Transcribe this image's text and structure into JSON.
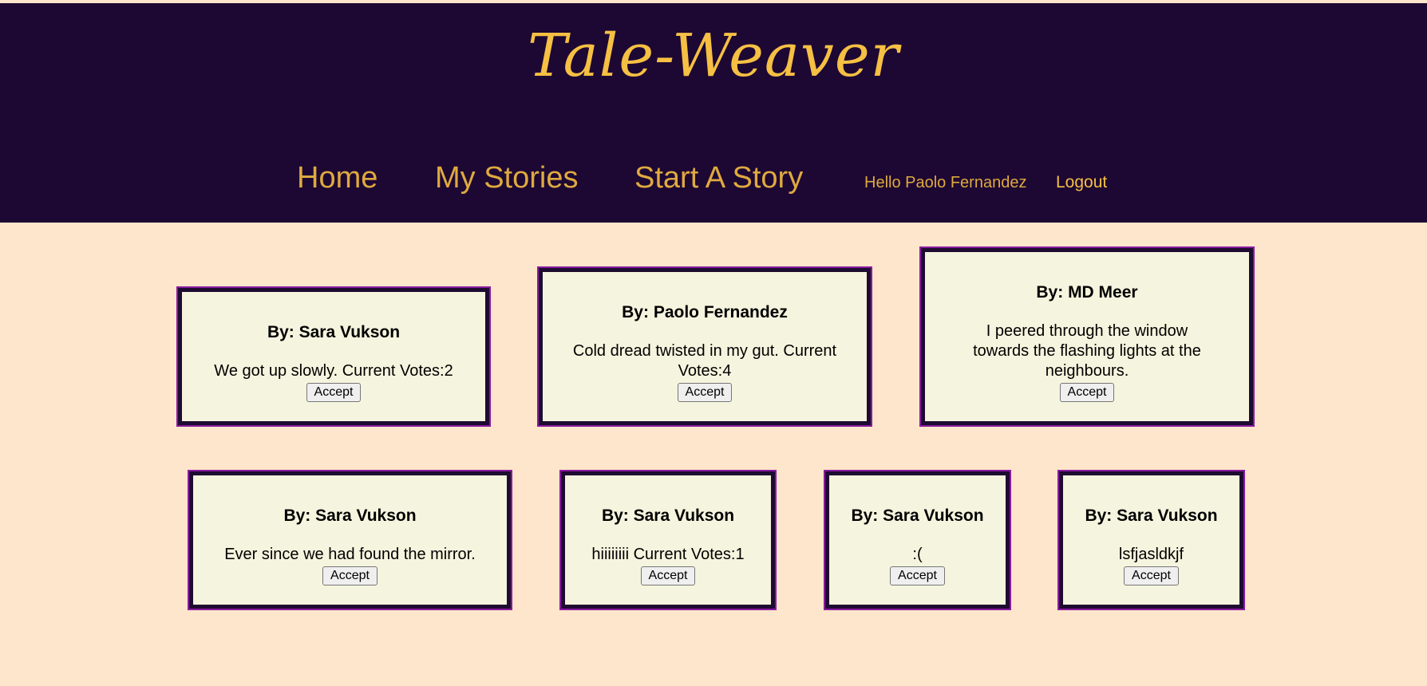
{
  "site": {
    "title": "Tale-Weaver"
  },
  "nav": {
    "home": "Home",
    "my_stories": "My Stories",
    "start_story": "Start A Story",
    "greeting": "Hello Paolo Fernandez",
    "logout": "Logout"
  },
  "cards": [
    {
      "author": "By: Sara Vukson",
      "text": "We got up slowly. Current Votes:2",
      "button": "Accept"
    },
    {
      "author": "By: Paolo Fernandez",
      "text": "Cold dread twisted in my gut. Current Votes:4",
      "button": "Accept"
    },
    {
      "author": "By: MD Meer",
      "text": "I peered through the window towards the flashing lights at the neighbours.",
      "button": "Accept"
    },
    {
      "author": "By: Sara Vukson",
      "text": "Ever since we had found the mirror.",
      "button": "Accept"
    },
    {
      "author": "By: Sara Vukson",
      "text": "hiiiiiiii Current Votes:1",
      "button": "Accept"
    },
    {
      "author": "By: Sara Vukson",
      "text": ":(",
      "button": "Accept"
    },
    {
      "author": "By: Sara Vukson",
      "text": "lsfjasldkjf",
      "button": "Accept"
    }
  ],
  "colors": {
    "header_bg": "#1d0733",
    "page_bg": "#fde6cb",
    "logo": "#f5c043",
    "nav_link": "#deaa3f",
    "card_bg": "#f5f4de",
    "card_border": "#1e0b31",
    "card_glow": "#8a1aa0"
  }
}
